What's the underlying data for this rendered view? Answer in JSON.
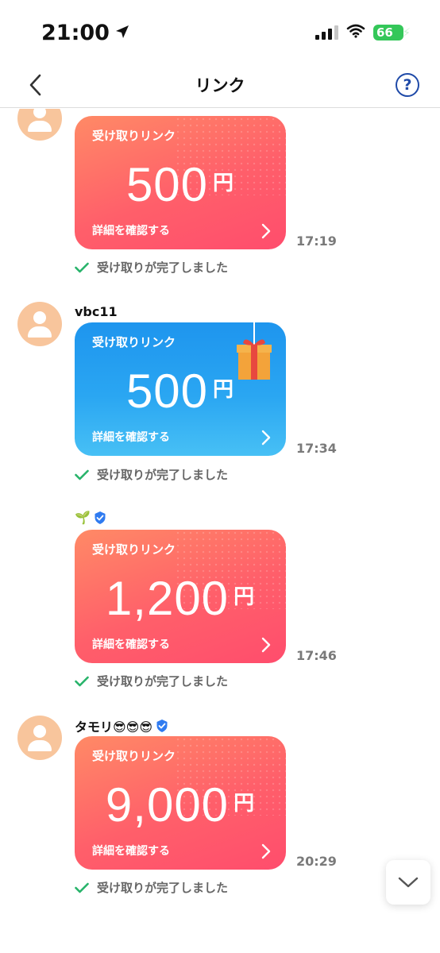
{
  "status_bar": {
    "time": "21:00",
    "battery": "66"
  },
  "nav": {
    "title": "リンク",
    "help": "?"
  },
  "messages": [
    {
      "sender": "",
      "card_label": "受け取りリンク",
      "amount": "500",
      "currency": "円",
      "detail": "詳細を確認する",
      "time": "17:19",
      "status": "受け取りが完了しました",
      "card_color": "red"
    },
    {
      "sender": "vbc11",
      "card_label": "受け取りリンク",
      "amount": "500",
      "currency": "円",
      "detail": "詳細を確認する",
      "time": "17:34",
      "status": "受け取りが完了しました",
      "card_color": "blue"
    },
    {
      "sender": "🌱",
      "card_label": "受け取りリンク",
      "amount": "1,200",
      "currency": "円",
      "detail": "詳細を確認する",
      "time": "17:46",
      "status": "受け取りが完了しました",
      "card_color": "red"
    },
    {
      "sender": "タモリ😎😎😎",
      "card_label": "受け取りリンク",
      "amount": "9,000",
      "currency": "円",
      "detail": "詳細を確認する",
      "time": "20:29",
      "status": "受け取りが完了しました",
      "card_color": "red"
    }
  ],
  "icons": {
    "location": "location-arrow-icon",
    "back": "chevron-left-icon",
    "help": "help-circle-icon",
    "verified": "verified-badge-icon",
    "check": "check-icon",
    "scroll_down": "chevron-down-icon",
    "gift": "gift-icon"
  },
  "colors": {
    "red_card": "#ff5f6a",
    "blue_card": "#2aa6f2",
    "check": "#27b36a",
    "help": "#1f4aa8",
    "battery": "#34c759"
  }
}
